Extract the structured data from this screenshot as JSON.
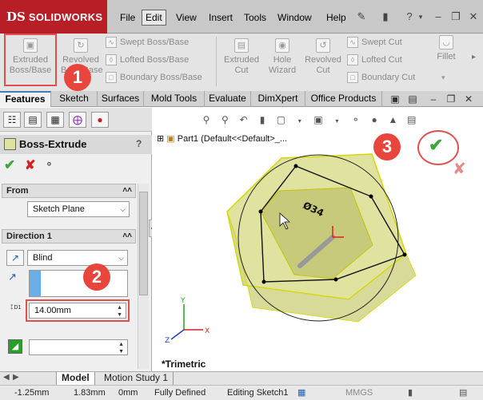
{
  "app": {
    "logo_ds": "DS",
    "logo_name": "SOLIDWORKS",
    "accent_color": "#b81e25"
  },
  "menu": {
    "items": [
      "File",
      "Edit",
      "View",
      "Insert",
      "Tools",
      "Window",
      "Help"
    ],
    "active": "Edit"
  },
  "ribbon": {
    "extruded_boss": "Extruded Boss/Base",
    "revolved_boss": "Revolved Boss/Base",
    "swept_boss": "Swept Boss/Base",
    "lofted_boss": "Lofted Boss/Base",
    "boundary_boss": "Boundary Boss/Base",
    "extruded_cut": "Extruded Cut",
    "hole_wizard": "Hole Wizard",
    "revolved_cut": "Revolved Cut",
    "swept_cut": "Swept Cut",
    "lofted_cut": "Lofted Cut",
    "boundary_cut": "Boundary Cut",
    "fillet": "Fillet"
  },
  "tabs": [
    "Features",
    "Sketch",
    "Surfaces",
    "Mold Tools",
    "Evaluate",
    "DimXpert",
    "Office Products"
  ],
  "property_manager": {
    "title": "Boss-Extrude",
    "help": "?",
    "from_header": "From",
    "from_value": "Sketch Plane",
    "direction_header": "Direction 1",
    "end_condition": "Blind",
    "depth_value": "14.00mm",
    "d1_label": "D1"
  },
  "graphics": {
    "tree_root": "Part1  (Default<<Default>_...",
    "view_label": "*Trimetric",
    "dimension_text": "Ø34"
  },
  "callouts": [
    "1",
    "2",
    "3"
  ],
  "bottom_tabs": [
    "Model",
    "Motion Study 1"
  ],
  "status": {
    "x": "-1.25mm",
    "y": "1.83mm",
    "z": "0mm",
    "state": "Fully Defined",
    "mode": "Editing Sketch1",
    "units": "MMGS"
  },
  "colors": {
    "callout": "#e8463c",
    "solid_fill": "#e0e3a0",
    "ok_green": "#3aa83a",
    "cancel_red": "#d82020"
  }
}
